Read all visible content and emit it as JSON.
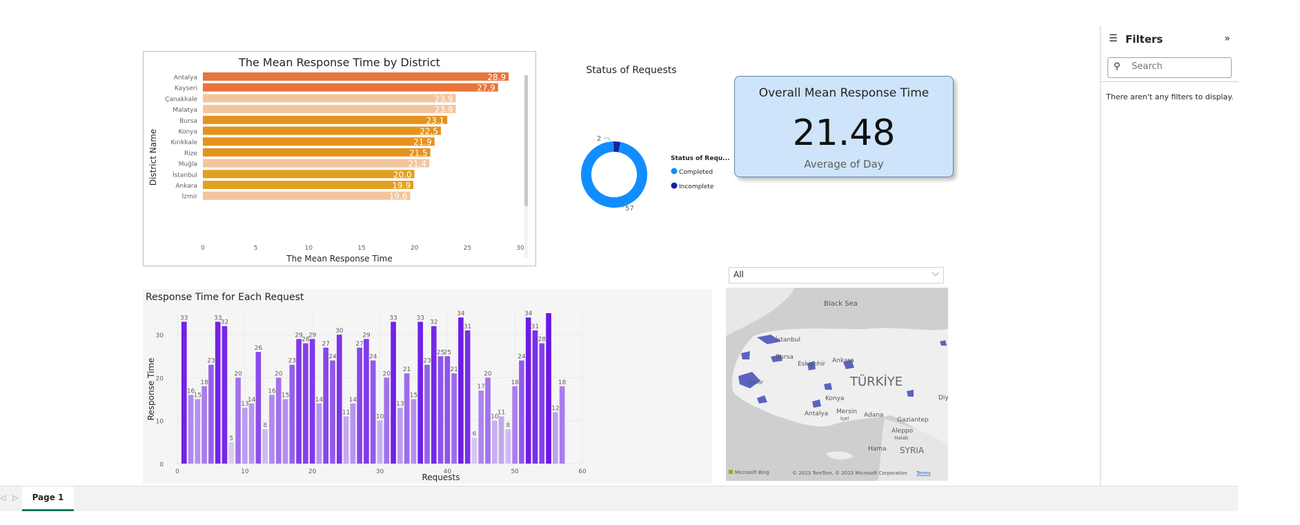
{
  "district_chart": {
    "title": "The Mean Response Time by District",
    "xlabel": "The Mean Response Time",
    "ylabel": "District Name"
  },
  "status_chart": {
    "title": "Status of Requests",
    "legend_title": "Status of Requ...",
    "data_labels": [
      "2",
      "57"
    ]
  },
  "kpi": {
    "title": "Overall Mean Response Time",
    "value": "21.48",
    "subtitle": "Average of Day"
  },
  "requests_chart": {
    "title": "Response Time for Each Request",
    "xlabel": "Requests",
    "ylabel": "Response Time"
  },
  "slicer": {
    "value": "All"
  },
  "map": {
    "labels": [
      "Black Sea",
      "İstanbul",
      "Bursa",
      "Eskişehir",
      "Ankara",
      "TÜRKİYE",
      "İzmir",
      "Konya",
      "Antalya",
      "Mersin",
      "İçel",
      "Adana",
      "Gaziantep",
      "Aleppo",
      "Halab",
      "Hama",
      "SYRIA",
      "Diy"
    ],
    "attribution": "© 2023 TomTom, © 2023 Microsoft Corporation",
    "terms": "Terms",
    "bing": "Microsoft Bing"
  },
  "filters": {
    "title": "Filters",
    "search_placeholder": "Search",
    "empty_text": "There aren't any filters to display."
  },
  "tabs": {
    "page1": "Page 1"
  },
  "chart_data": [
    {
      "type": "bar",
      "orientation": "horizontal",
      "title": "The Mean Response Time by District",
      "xlabel": "The Mean Response Time",
      "ylabel": "District Name",
      "categories": [
        "Antalya",
        "Kayseri",
        "Çanakkale",
        "Malatya",
        "Bursa",
        "Konya",
        "Kırıkkale",
        "Rize",
        "Muğla",
        "İstanbul",
        "Ankara",
        "İzmir"
      ],
      "values": [
        28.9,
        27.9,
        23.9,
        23.9,
        23.1,
        22.5,
        21.9,
        21.5,
        21.4,
        20.0,
        19.9,
        19.6
      ],
      "value_labels": [
        "28.9",
        "27.9",
        "23.9",
        "23.9",
        "23.1",
        "22.5",
        "21.9",
        "21.5",
        "21.4",
        "20.0",
        "19.9",
        "19.6"
      ],
      "xlim": [
        0,
        30
      ],
      "xticks": [
        "0",
        "5",
        "10",
        "15",
        "20",
        "25",
        "30"
      ],
      "colors": [
        "#e8743b",
        "#e8743b",
        "#f3c59e",
        "#f3c59e",
        "#e5931f",
        "#e5931f",
        "#e5931f",
        "#e5931f",
        "#f3c59e",
        "#e0a021",
        "#e0a021",
        "#f3c59e"
      ]
    },
    {
      "type": "pie",
      "variant": "donut",
      "title": "Status of Requests",
      "legend_title": "Status of Requ...",
      "categories": [
        "Completed",
        "Incomplete"
      ],
      "values": [
        57,
        2
      ],
      "colors": [
        "#118dff",
        "#12239e"
      ]
    },
    {
      "type": "bar",
      "title": "Response Time for Each Request",
      "xlabel": "Requests",
      "ylabel": "Response Time",
      "x": [
        1,
        2,
        3,
        4,
        5,
        6,
        7,
        8,
        9,
        10,
        11,
        12,
        13,
        14,
        15,
        16,
        17,
        18,
        19,
        20,
        21,
        22,
        23,
        24,
        25,
        26,
        27,
        28,
        29,
        30,
        31,
        32,
        33,
        34,
        35,
        36,
        37,
        38,
        39,
        40,
        41,
        42,
        43,
        44,
        45,
        46,
        47,
        48,
        49,
        50,
        51,
        52,
        53,
        54,
        55,
        56,
        57
      ],
      "values": [
        33,
        16,
        15,
        18,
        23,
        33,
        32,
        5,
        20,
        13,
        14,
        26,
        8,
        16,
        20,
        15,
        23,
        29,
        28,
        29,
        14,
        27,
        24,
        30,
        11,
        14,
        27,
        29,
        24,
        10,
        20,
        33,
        13,
        21,
        15,
        33,
        23,
        32,
        25,
        25,
        21,
        34,
        31,
        6,
        17,
        20,
        10,
        11,
        8,
        18,
        24,
        34,
        31,
        28,
        35,
        12,
        18
      ],
      "value_labels": [
        "33",
        "16",
        "15",
        "18",
        "23",
        "33",
        "32",
        "5",
        "20",
        "13",
        "14",
        "26",
        "8",
        "16",
        "20",
        "15",
        "23",
        "29",
        "28",
        "29",
        "14",
        "27",
        "24",
        "30",
        "11",
        "14",
        "27",
        "29",
        "24",
        "10",
        "20",
        "33",
        "13",
        "21",
        "15",
        "33",
        "23",
        "32",
        "25",
        "25",
        "21",
        "34",
        "31",
        "6",
        "17",
        "20",
        "10",
        "11",
        "8",
        "18",
        "24",
        "34",
        "31",
        "28",
        "",
        "12",
        "18"
      ],
      "xlim": [
        0,
        60
      ],
      "ylim": [
        0,
        35
      ],
      "xticks": [
        "0",
        "10",
        "20",
        "30",
        "40",
        "50",
        "60"
      ],
      "yticks": [
        "0",
        "10",
        "20",
        "30"
      ],
      "color_scale": [
        "#d9ccf3",
        "#6a16e6"
      ]
    }
  ]
}
